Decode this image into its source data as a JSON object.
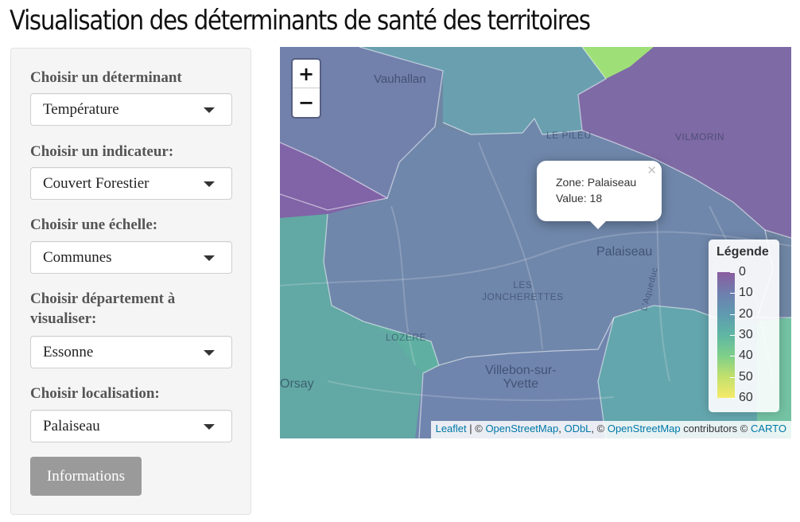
{
  "page": {
    "title": "Visualisation des déterminants de santé des territoires"
  },
  "sidebar": {
    "controls": [
      {
        "label": "Choisir un déterminant",
        "value": "Température"
      },
      {
        "label": "Choisir un indicateur:",
        "value": "Couvert Forestier"
      },
      {
        "label": "Choisir une échelle:",
        "value": "Communes"
      },
      {
        "label": "Choisir département à visualiser:",
        "value": "Essonne"
      },
      {
        "label": "Choisir localisation:",
        "value": "Palaiseau"
      }
    ],
    "info_button": "Informations"
  },
  "map": {
    "zoom_in": "+",
    "zoom_out": "−",
    "place_labels": {
      "vauhallan": "Vauhallan",
      "le_pileu": "LE PILEU",
      "vilmorin": "VILMORIN",
      "palaiseau": "Palaiseau",
      "les_joncherettes": "LES\nJONCHERETTES",
      "lozere": "LOZÈRE",
      "orsay": "Orsay",
      "villebon": "Villebon-sur-\nYvette",
      "laqueduc": "L'Aqueduc"
    },
    "popup": {
      "zone_line": "Zone: Palaiseau",
      "value_line": "Value: 18",
      "zone": "Palaiseau",
      "value": 18
    },
    "legend": {
      "title": "Légende",
      "ticks": [
        "0",
        "10",
        "20",
        "30",
        "40",
        "50",
        "60"
      ],
      "colors": [
        "#8a5c9e",
        "#6f7fae",
        "#5f9ab0",
        "#5fb6a3",
        "#7fcf8a",
        "#c3e06c",
        "#f5ea6a"
      ]
    },
    "attribution": {
      "leaflet": "Leaflet",
      "sep1": " | © ",
      "osm1": "OpenStreetMap",
      "comma": ", ",
      "odbl": "ODbL",
      "sep2": ", © ",
      "osm2": "OpenStreetMap",
      "contributors": " contributors © ",
      "carto": "CARTO"
    }
  },
  "colors": {
    "purple_zone": "#8561a3",
    "blue_zone": "#6f86a4",
    "teal_zone": "#6aa6ab",
    "green_zone": "#6fbfa0",
    "lime_zone": "#9de079",
    "link": "#0078a8",
    "button_bg": "#9a9a9a"
  }
}
